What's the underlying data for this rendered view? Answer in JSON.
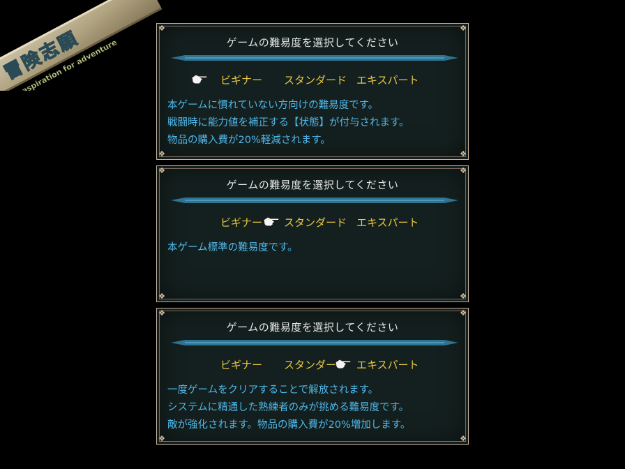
{
  "logo": {
    "title_text": "冒険志願",
    "subtitle_text": "aspiration for adventure"
  },
  "panels": [
    {
      "title": "ゲームの難易度を選択してください",
      "options": [
        "ビギナー",
        "スタンダード",
        "エキスパート"
      ],
      "selected_option": "ビギナー",
      "description": [
        "本ゲームに慣れていない方向けの難易度です。",
        "戦闘時に能力値を補正する【状態】が付与されます。",
        "物品の購入費が20%軽減されます。"
      ]
    },
    {
      "title": "ゲームの難易度を選択してください",
      "options": [
        "ビギナー",
        "スタンダード",
        "エキスパート"
      ],
      "selected_option": "スタンダード",
      "description": [
        "本ゲーム標準の難易度です。"
      ]
    },
    {
      "title": "ゲームの難易度を選択してください",
      "options": [
        "ビギナー",
        "スタンダード",
        "エキスパート"
      ],
      "selected_option": "エキスパート",
      "description": [
        "一度ゲームをクリアすることで解放されます。",
        "システムに精通した熟練者のみが挑める難易度です。",
        "敵が強化されます。物品の購入費が20%増加します。"
      ]
    }
  ],
  "icons": {
    "pointer": "pointing-hand-icon",
    "corner": "ornament-corner-icon"
  },
  "colors": {
    "background": "#000000",
    "panel_bg": "#14201f",
    "panel_border": "#c9b39a",
    "title_text": "#e6e6e6",
    "option_text": "#e9c743",
    "description_text": "#4fb6e8",
    "divider": "#3a8fb8"
  }
}
